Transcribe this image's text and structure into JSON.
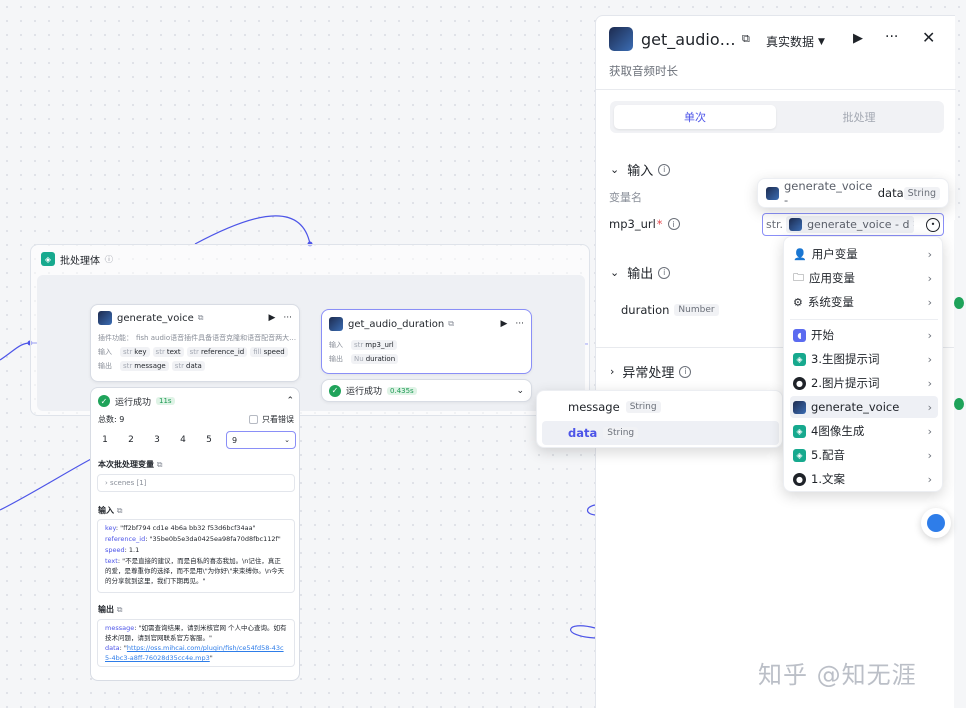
{
  "batch": {
    "title": "批处理体"
  },
  "node_voice": {
    "title": "generate_voice",
    "desc_label": "插件功能：",
    "desc": "fish audio语音插件具备语音克隆和语音配音两大…",
    "input_label": "输入",
    "inputs": [
      "key",
      "text",
      "reference_id",
      "speed"
    ],
    "output_label": "输出",
    "outputs": [
      {
        "type": "str",
        "name": "message"
      },
      {
        "type": "str",
        "name": "data"
      }
    ]
  },
  "node_duration": {
    "title": "get_audio_duration",
    "input_label": "输入",
    "input_param": "mp3_url",
    "output_label": "输出",
    "output_param": "duration",
    "status": "运行成功",
    "time": "0.435s"
  },
  "run": {
    "status": "运行成功",
    "time": "11s",
    "total": "总数: 9",
    "errors_only": "只看错误",
    "pages": [
      "1",
      "2",
      "3",
      "4",
      "5"
    ],
    "page_select": "9",
    "batch_vars_title": "本次批处理变量",
    "batch_var": "scenes [1]",
    "input_title": "输入",
    "input_lines": [
      {
        "k": "key",
        "v": ": \"ff2bf794 cd1e 4b6a bb32 f53d6bcf34aa\""
      },
      {
        "k": "reference_id",
        "v": ": \"35be0b5e3da0425ea98fa70d8fbc112f\""
      },
      {
        "k": "speed",
        "v": ": 1.1"
      },
      {
        "k": "text",
        "v": ": \"不是直接的建议，而是自私的喜态我加。\\n记住，真正的爱，是尊重你的选择，而不是用\\\"为你好\\\"来束缚你。\\n今天的分享就到这里，我们下期再见。\""
      }
    ],
    "output_title": "输出",
    "output_lines": [
      {
        "k": "message",
        "v": ": \"如需查询结果，请到米核官网 个人中心查询。如有技术问题，请到官网联系官方客服。\""
      },
      {
        "k": "data",
        "v": ": \"",
        "link": "https://oss.mihcai.com/plugin/fish/ce54fd58-43c5-4bc3-a8ff-76028d35cc4e.mp3",
        "end": "\""
      }
    ]
  },
  "panel": {
    "title": "get_audio…",
    "data_mode": "真实数据",
    "subtitle": "获取音频时长",
    "tab_single": "单次",
    "tab_batch": "批处理",
    "input_section": "输入",
    "var_name_label": "变量名",
    "param_name": "mp3_url",
    "param_value": "generate_voice - d",
    "output_section": "输出",
    "output_param": "duration",
    "output_type": "Number",
    "error_section": "异常处理"
  },
  "tooltip": {
    "source": "generate_voice - ",
    "field": "data",
    "type": "String"
  },
  "field_menu": [
    {
      "name": "message",
      "type": "String"
    },
    {
      "name": "data",
      "type": "String"
    }
  ],
  "var_menu": [
    {
      "label": "用户变量",
      "icon": "user-icon"
    },
    {
      "label": "应用变量",
      "icon": "folder-icon"
    },
    {
      "label": "系统变量",
      "icon": "gear-icon"
    },
    {
      "label": "开始",
      "icon": "start-icon",
      "color": "#5b6bf0"
    },
    {
      "label": "3.生图提示词",
      "icon": "layers-icon",
      "color": "#17a98e"
    },
    {
      "label": "2.图片提示词",
      "icon": "bot-icon",
      "color": "#1f2329"
    },
    {
      "label": "generate_voice",
      "icon": "plugin-avatar-icon",
      "color": "#2b4a7e"
    },
    {
      "label": "4图像生成",
      "icon": "layers-icon",
      "color": "#17a98e"
    },
    {
      "label": "5.配音",
      "icon": "layers-icon",
      "color": "#17a98e"
    },
    {
      "label": "1.文案",
      "icon": "bot-icon",
      "color": "#1f2329"
    }
  ],
  "watermark": "知乎 @知无涯",
  "colors": {
    "accent": "#4d55e8",
    "success": "#1fa35a",
    "teal": "#17a98e"
  }
}
